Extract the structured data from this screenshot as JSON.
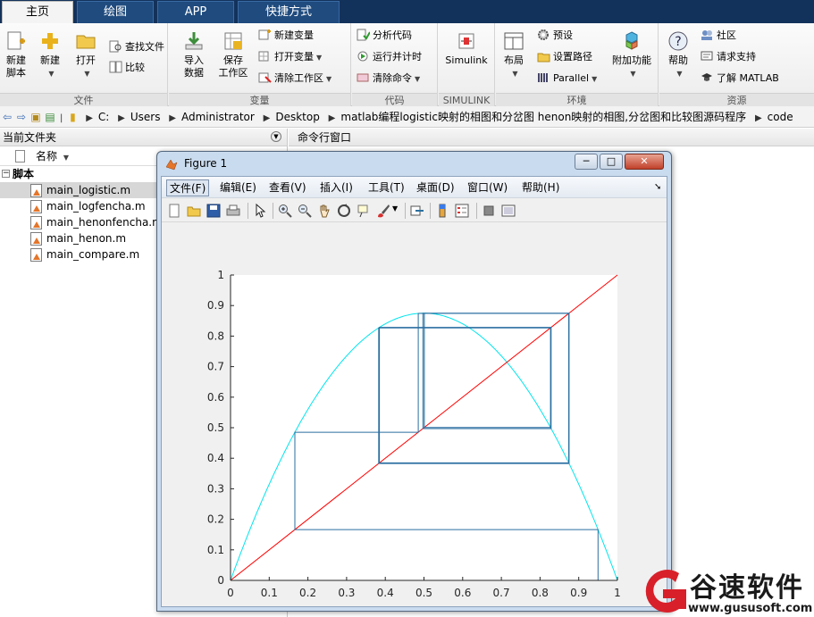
{
  "tabs": [
    {
      "label": "主页",
      "active": true
    },
    {
      "label": "绘图",
      "active": false
    },
    {
      "label": "APP",
      "active": false
    },
    {
      "label": "快捷方式",
      "active": false
    }
  ],
  "ribbon": {
    "file": {
      "label": "文件",
      "new_script": "新建\n脚本",
      "new": "新建",
      "open": "打开",
      "find_files": "查找文件",
      "compare": "比较"
    },
    "variable": {
      "label": "变量",
      "import": "导入\n数据",
      "save_ws": "保存\n工作区",
      "new_var": "新建变量",
      "open_var": "打开变量",
      "clear_ws": "清除工作区"
    },
    "code": {
      "label": "代码",
      "analyze": "分析代码",
      "run_time": "运行并计时",
      "clear_cmd": "清除命令"
    },
    "simulink": {
      "label": "SIMULINK",
      "button": "Simulink"
    },
    "env": {
      "label": "环境",
      "layout": "布局",
      "prefs": "预设",
      "set_path": "设置路径",
      "parallel": "Parallel",
      "addons": "附加功能"
    },
    "resources": {
      "label": "资源",
      "help": "帮助",
      "community": "社区",
      "support": "请求支持",
      "learn": "了解 MATLAB"
    }
  },
  "address": {
    "parts": [
      "C:",
      "Users",
      "Administrator",
      "Desktop",
      "matlab编程logistic映射的相图和分岔图 henon映射的相图,分岔图和比较图源码程序",
      "code"
    ]
  },
  "left_panel": {
    "title": "当前文件夹",
    "column": "名称",
    "folder": "脚本",
    "files": [
      "main_logistic.m",
      "main_logfencha.m",
      "main_henonfencha.m",
      "main_henon.m",
      "main_compare.m"
    ],
    "selected_index": 0
  },
  "right_panel": {
    "title": "命令行窗口"
  },
  "figure": {
    "title": "Figure 1",
    "menus": [
      {
        "label": "文件(F)",
        "active": true
      },
      {
        "label": "编辑(E)",
        "active": false
      },
      {
        "label": "查看(V)",
        "active": false
      },
      {
        "label": "插入(I)",
        "active": false
      },
      {
        "label": "工具(T)",
        "active": false
      },
      {
        "label": "桌面(D)",
        "active": false
      },
      {
        "label": "窗口(W)",
        "active": false
      },
      {
        "label": "帮助(H)",
        "active": false
      }
    ],
    "minimize": "─",
    "maximize": "□",
    "close": "✕"
  },
  "chart_data": {
    "type": "line",
    "title": "",
    "xlabel": "",
    "ylabel": "",
    "xlim": [
      0,
      1
    ],
    "ylim": [
      0,
      1
    ],
    "xticks": [
      0,
      0.1,
      0.2,
      0.3,
      0.4,
      0.5,
      0.6,
      0.7,
      0.8,
      0.9,
      1
    ],
    "yticks": [
      0,
      0.1,
      0.2,
      0.3,
      0.4,
      0.5,
      0.6,
      0.7,
      0.8,
      0.9,
      1
    ],
    "grid": false,
    "logistic_r": 3.5,
    "series": [
      {
        "kind": "curve",
        "function": "r*x*(1-x)",
        "color": "#00e5ee"
      },
      {
        "kind": "diagonal",
        "function": "x",
        "color": "#ff0000"
      },
      {
        "kind": "cobweb",
        "x0": 0.95,
        "iterations": 40,
        "color": "#2a6fa0"
      }
    ]
  },
  "watermark": {
    "text": "谷速软件",
    "url": "www.gususoft.com"
  },
  "colors": {
    "tabbar": "#13325b",
    "accent": "#1f4b7e",
    "logo_red": "#d8202a"
  }
}
